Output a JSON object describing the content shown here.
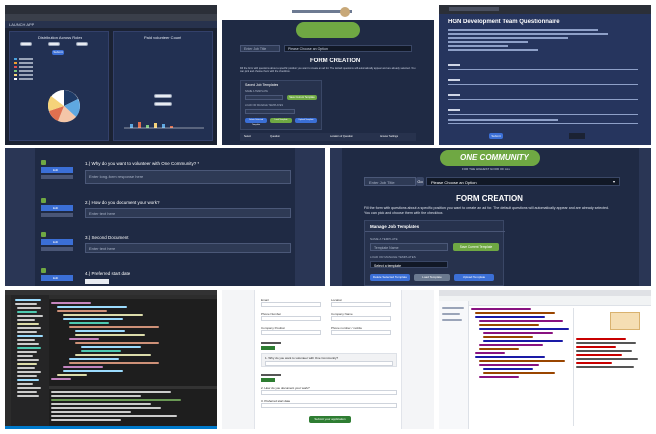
{
  "tile1": {
    "tab": "LAUNCH APP",
    "left_chart_title": "Distribution Across Roles",
    "right_chart_title": "Paid volunteer Count",
    "button": "Submit"
  },
  "tile2": {
    "search_placeholder": "Enter Job Title",
    "select_label": "Please Choose an Option",
    "title": "FORM CREATION",
    "desc": "Fill the form with questions about a specific position you want to create an ad for. The default questions will automatically appear and are already selected. You can pick and choose them with the checkbox.",
    "saved_header": "Saved Job Templates",
    "name_label": "NAME A TEMPLATE",
    "name_placeholder": "Template Name",
    "save_btn": "Save Current Template",
    "load_label": "LOAD OR MANAGE TEMPLATES",
    "select_template": "Select a template",
    "delete_btn": "Delete Selected Template",
    "load_btn": "Load Template",
    "upload_btn": "Upload Template",
    "table_headers": [
      "Select",
      "Question",
      "Location of Question",
      "Answer Settings"
    ]
  },
  "tile3": {
    "title": "HGN Development Team Questionnaire",
    "submit": "Submit"
  },
  "tile4": {
    "q1": "1.) Why do you want to volunteer with One Community? *",
    "q1_placeholder": "Enter long-form response here",
    "q2": "2.) How do you document your work?",
    "q2_placeholder": "Enter text here",
    "q3": "3.) Second Document",
    "q3_placeholder": "Enter text here",
    "q4": "4.) Preferred start date",
    "edit": "Edit"
  },
  "tile5": {
    "logo_top": "ONE COMMUNITY",
    "logo_sub": "FOR THE HIGHEST GOOD OF ALL",
    "search_placeholder": "Enter Job Title",
    "go": "Go",
    "select_label": "Please Choose an Option",
    "title": "FORM CREATION",
    "desc1": "Fill the form with questions about a specific position you want to create an ad for. The default questions will automatically appear and are already selected.",
    "desc2": "You can pick and choose them with the checkbox.",
    "saved_header": "Manage Job Templates",
    "name_label": "NAME A TEMPLATE",
    "name_placeholder": "Template Name",
    "save_btn": "Save Current Template",
    "load_label": "LOAD OR MANAGE TEMPLATES",
    "select_template": "Select a template",
    "delete_btn": "Delete Selected Template",
    "load_btn": "Load Template",
    "upload_btn": "Upload Template"
  },
  "tile7": {
    "fields": [
      "Email",
      "Location",
      "Phone Number",
      "Company Name",
      "Company Position",
      "Phone number / mobile"
    ],
    "q1": "1. Why do you want to volunteer with One Community?",
    "q2": "2. How do you document your work?",
    "q3": "3. Preferred start date",
    "submit": "Submit your application"
  },
  "colors": {
    "navy": "#1f2a44",
    "accent_green": "#6fa843",
    "accent_blue": "#3b6fd6"
  }
}
